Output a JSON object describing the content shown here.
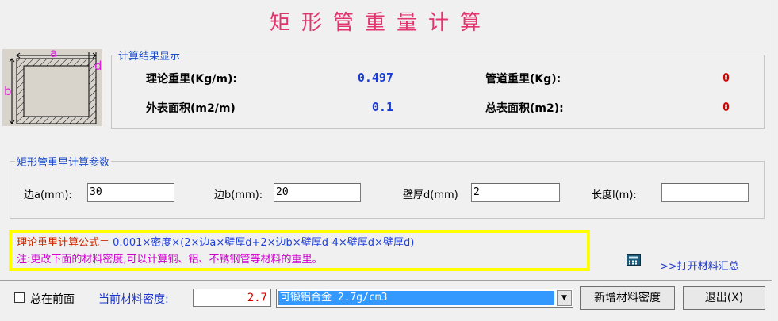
{
  "title": "矩形管重量计算",
  "diagram": {
    "label_a": "a",
    "label_b": "b",
    "label_d": "d"
  },
  "results": {
    "legend": "计算结果显示",
    "theory_weight_label": "理论重里(Kg/m):",
    "theory_weight_value": "0.497",
    "pipe_weight_label": "管道重里(Kg):",
    "pipe_weight_value": "0",
    "surface_area_label": "外表面积(m2/m)",
    "surface_area_value": "0.1",
    "total_area_label": "总表面积(m2):",
    "total_area_value": "0"
  },
  "params": {
    "legend": "矩形管重里计算参数",
    "side_a_label": "边a(mm):",
    "side_a_value": "30",
    "side_b_label": "边b(mm):",
    "side_b_value": "20",
    "thickness_label": "壁厚d(mm)",
    "thickness_value": "2",
    "length_label": "长度l(m):",
    "length_value": ""
  },
  "formula": {
    "prefix": "理论重里计算公式＝",
    "expression": " 0.001×密度×(2×边a×壁厚d+2×边b×壁厚d-4×壁厚d×壁厚d)",
    "note": "注:更改下面的材料密度,可以计算铜、铝、不锈钢管等材料的重里。"
  },
  "material_link": ">>打开材料汇总",
  "bottom": {
    "always_on_top_label": "总在前面",
    "density_label": "当前材料密度:",
    "density_value": "2.7",
    "material_selected": "可锻铝合金 2.7g/cm3",
    "add_density_button": "新增材料密度",
    "exit_button": "退出(X)"
  }
}
